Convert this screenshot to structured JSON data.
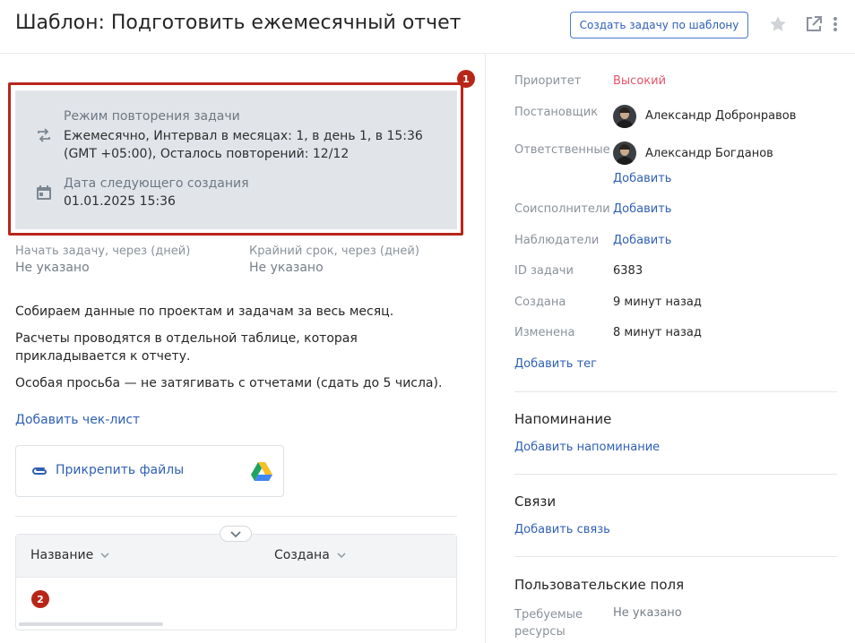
{
  "header": {
    "title": "Шаблон: Подготовить ежемесячный отчет",
    "create_button": "Создать задачу по шаблону"
  },
  "markers": [
    "1",
    "2"
  ],
  "recurrence": {
    "mode_label": "Режим повторения задачи",
    "mode_value": "Ежемесячно, Интервал в месяцах: 1, в день 1, в 15:36 (GMT +05:00), Осталось повторений: 12/12",
    "next_label": "Дата следующего создания",
    "next_value": "01.01.2025 15:36"
  },
  "fields": {
    "start_label": "Начать задачу, через (дней)",
    "start_value": "Не указано",
    "deadline_label": "Крайний срок, через (дней)",
    "deadline_value": "Не указано"
  },
  "description": [
    "Собираем данные по проектам и задачам за весь месяц.",
    "Расчеты проводятся в отдельной таблице, которая прикладывается к отчету.",
    "Особая просьба — не затягивать с отчетами (сдать до 5 числа)."
  ],
  "checklist": {
    "add_label": "Добавить чек-лист"
  },
  "attachments": {
    "label": "Прикрепить файлы"
  },
  "table": {
    "columns": [
      "Название",
      "Создана"
    ]
  },
  "sidebar": {
    "priority_label": "Приоритет",
    "priority_value": "Высокий",
    "creator_label": "Постановщик",
    "creator_name": "Александр Добронравов",
    "responsible_label": "Ответственные",
    "responsible_name": "Александр Богданов",
    "add": "Добавить",
    "coexecutors_label": "Соисполнители",
    "observers_label": "Наблюдатели",
    "task_id_label": "ID задачи",
    "task_id_value": "6383",
    "created_label": "Создана",
    "created_value": "9 минут назад",
    "modified_label": "Изменена",
    "modified_value": "8 минут назад",
    "add_tag": "Добавить тег",
    "reminder_title": "Напоминание",
    "add_reminder": "Добавить напоминание",
    "links_title": "Связи",
    "add_link": "Добавить связь",
    "custom_fields_title": "Пользовательские поля",
    "required_resources_label": "Требуемые ресурсы",
    "required_resources_value": "Не указано"
  },
  "colors": {
    "accent": "#2f5fb5",
    "priority": "#e8546b",
    "highlight": "#b8261a",
    "recur_bg": "#e1e5ea"
  }
}
